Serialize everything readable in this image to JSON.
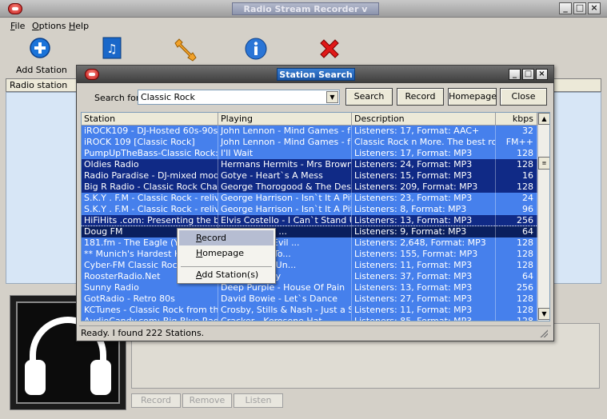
{
  "app": {
    "title": "Radio Stream Recorder v",
    "menu": [
      "File",
      "Options",
      "Help"
    ],
    "menu_underline": [
      "F",
      "O",
      "H"
    ],
    "menu_rest": [
      "ile",
      "ptions",
      "elp"
    ],
    "toolbar": [
      {
        "label": "Add Station",
        "icon": "add-icon"
      },
      {
        "label": "",
        "icon": "music-file-icon"
      },
      {
        "label": "",
        "icon": "wrench-icon"
      },
      {
        "label": "",
        "icon": "info-icon"
      },
      {
        "label": "",
        "icon": "exit-icon"
      }
    ],
    "list_header": "Radio station",
    "bottom_buttons": [
      "Record",
      "Remove",
      "Listen"
    ]
  },
  "dialog": {
    "title": "Station Search",
    "search_label": "Search for",
    "search_value": "Classic Rock",
    "buttons": [
      "Search",
      "Record",
      "Homepage",
      "Close"
    ],
    "columns": [
      "Station",
      "Playing",
      "Description",
      "kbps"
    ],
    "rows": [
      {
        "station": "iROCK109 - DJ-Hosted 60s-90s ...",
        "playing": "John Lennon - Mind Games - fre...",
        "desc": "Listeners: 17, Format: AAC+",
        "kbps": "32"
      },
      {
        "station": "iROCK 109 [Classic Rock]",
        "playing": "John Lennon - Mind Games - fre...",
        "desc": "Classic Rock n More. The best ro...",
        "kbps": "FM++"
      },
      {
        "station": "PumpUpTheBass-Classic Rock: ...",
        "playing": "I'll Wait",
        "desc": "Listeners: 17, Format: MP3",
        "kbps": "128"
      },
      {
        "station": "Oldies Radio",
        "playing": "Hermans Hermits - Mrs Brown ...",
        "desc": "Listeners: 24, Format: MP3",
        "kbps": "128"
      },
      {
        "station": "Radio Paradise - DJ-mixed mode...",
        "playing": "Gotye - Heart`s A Mess",
        "desc": "Listeners: 15, Format: MP3",
        "kbps": "16"
      },
      {
        "station": "Big R Radio - Classic Rock Cha...",
        "playing": "George Thorogood & The Dest...",
        "desc": "Listeners: 209, Format: MP3",
        "kbps": "128"
      },
      {
        "station": "S.K.Y . F.M - Classic Rock - reliv...",
        "playing": "George Harrison - Isn`t It A Pity",
        "desc": "Listeners: 23, Format: MP3",
        "kbps": "24"
      },
      {
        "station": "S.K.Y . F.M - Classic Rock - reliv...",
        "playing": "George Harrison - Isn`t It A Pity",
        "desc": "Listeners: 8, Format: MP3",
        "kbps": "96"
      },
      {
        "station": "HiFiHits .com: Presenting the be...",
        "playing": "Elvis Costello - I Can`t Stand Up",
        "desc": "Listeners: 13, Format: MP3",
        "kbps": "256"
      },
      {
        "station": "Doug FM",
        "playing": "BENNIE AND ...",
        "desc": "Listeners: 9, Format: MP3",
        "kbps": "64"
      },
      {
        "station": "181.fm - The Eagle (Your...",
        "playing": "Orchestra - Evil ...",
        "desc": "Listeners: 2,648, Format: MP3",
        "kbps": "128"
      },
      {
        "station": "** Munich's Hardest Hits",
        "playing": "Two Tickets To...",
        "desc": "Listeners: 155, Format: MP3",
        "kbps": "128"
      },
      {
        "station": "Cyber-FM Classic Rock",
        "playing": "ars of Rock (Un...",
        "desc": "Listeners: 11, Format: MP3",
        "kbps": "128"
      },
      {
        "station": "RoosterRadio.Net",
        "playing": "Dirty Laundry",
        "desc": "Listeners: 37, Format: MP3",
        "kbps": "64"
      },
      {
        "station": "Sunny Radio",
        "playing": "Deep Purple - House Of Pain",
        "desc": "Listeners: 13, Format: MP3",
        "kbps": "256"
      },
      {
        "station": "GotRadio - Retro 80s",
        "playing": "David Bowie - Let`s Dance",
        "desc": "Listeners: 27, Format: MP3",
        "kbps": "128"
      },
      {
        "station": "KCTunes - Classic Rock from th...",
        "playing": "Crosby, Stills & Nash - Just a S...",
        "desc": "Listeners: 11, Format: MP3",
        "kbps": "128"
      },
      {
        "station": "AudioCandy.com: Big Blue Radi...",
        "playing": "Cracker - Kerosene Hat",
        "desc": "Listeners: 85, Format: MP3",
        "kbps": "128"
      }
    ],
    "status": "Ready. I found 222 Stations."
  },
  "context_menu": {
    "items": [
      "Record",
      "Homepage",
      "Add Station(s)"
    ],
    "underline": [
      "R",
      "H",
      "A"
    ],
    "rest": [
      "ecord",
      "omepage",
      "dd Station(s)"
    ],
    "selected": "Record"
  },
  "colors": {
    "row_light": "#4680ec",
    "row_dark": "#102a86",
    "row_focus": "#0a1f5e",
    "text_on_row": "#ffffff"
  }
}
